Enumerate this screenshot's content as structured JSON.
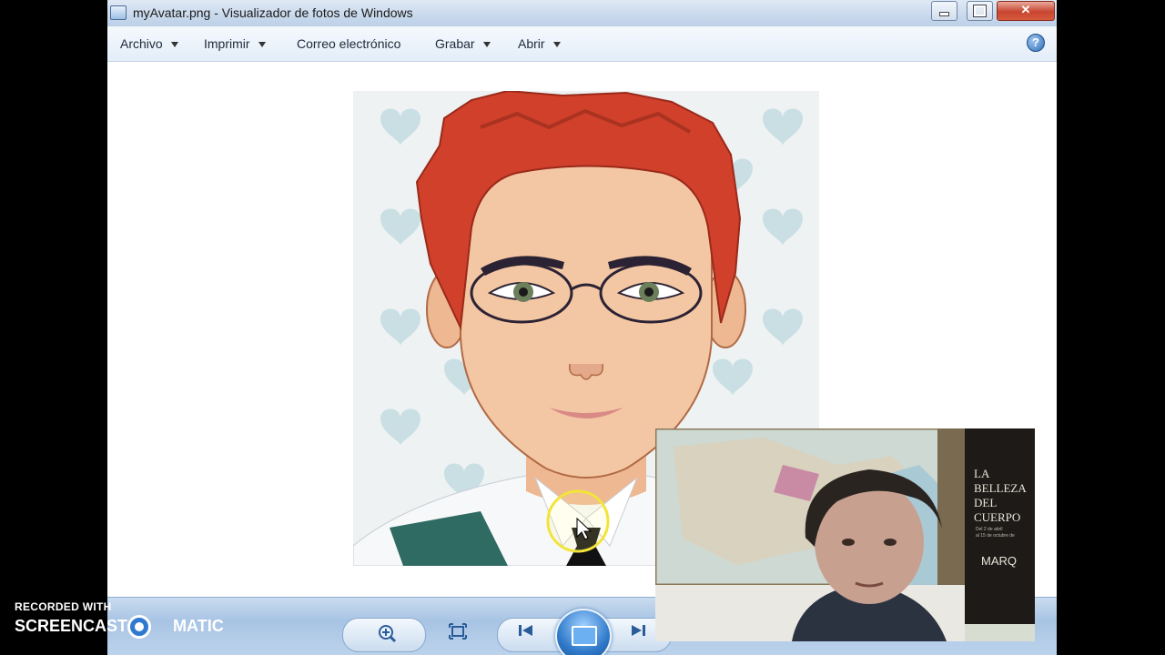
{
  "window": {
    "title": "myAvatar.png - Visualizador de fotos de Windows",
    "close_glyph": "✕"
  },
  "menu": {
    "items": [
      {
        "label": "Archivo",
        "has_dropdown": true
      },
      {
        "label": "Imprimir",
        "has_dropdown": true
      },
      {
        "label": "Correo electrónico",
        "has_dropdown": false
      },
      {
        "label": "Grabar",
        "has_dropdown": true
      },
      {
        "label": "Abrir",
        "has_dropdown": true
      }
    ],
    "help_glyph": "?"
  },
  "toolbar": {
    "zoom_icon": "magnifier-plus-icon",
    "fit_icon": "fit-window-icon",
    "prev_icon": "previous-icon",
    "slideshow_icon": "slideshow-icon",
    "next_icon": "next-icon"
  },
  "poster": {
    "lines": [
      "LA",
      "BELLEZA",
      "DEL",
      "CUERPO"
    ],
    "small": [
      "Del 2 de abril",
      "al 15 de octubre de"
    ],
    "brand": "MARQ"
  },
  "watermark": {
    "line1": "RECORDED WITH",
    "line2a": "SCREENCAST",
    "line2b": "MATIC"
  },
  "colors": {
    "hair": "#d0402b",
    "skin": "#f4c7a4",
    "heart": "#c9dfe4",
    "accent": "#2f79c9"
  }
}
